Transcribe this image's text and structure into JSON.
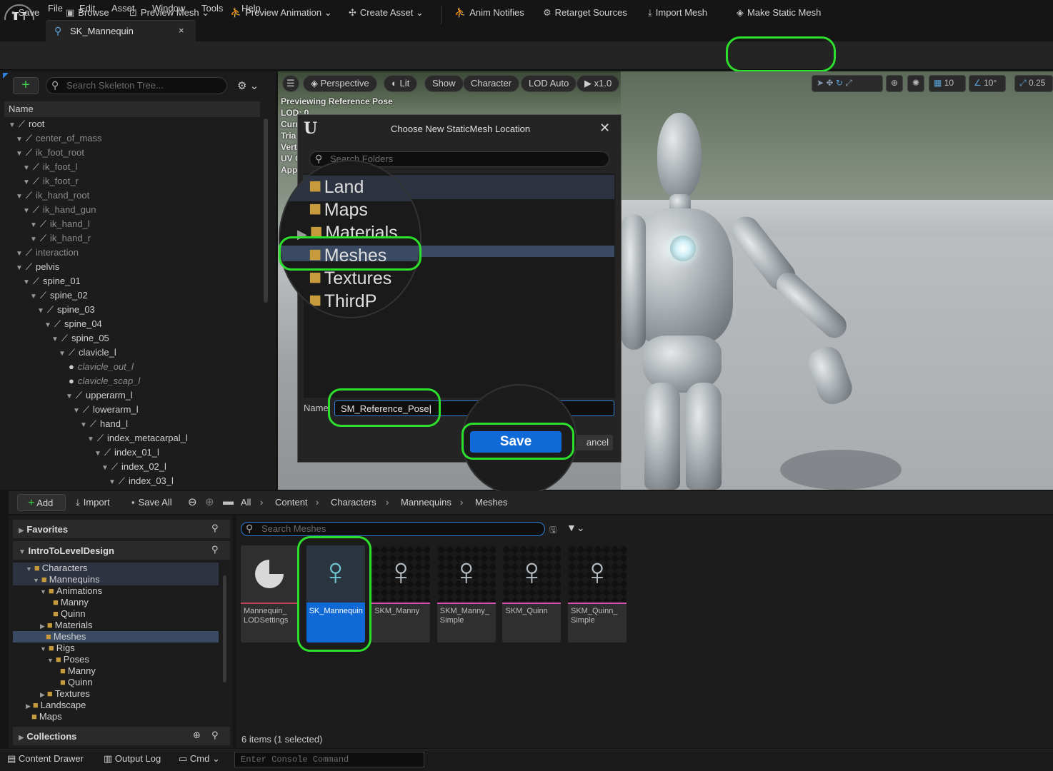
{
  "menu": [
    "File",
    "Edit",
    "Asset",
    "Window",
    "Tools",
    "Help"
  ],
  "doc_tab": {
    "label": "SK_Mannequin",
    "close": "×"
  },
  "toolbar": {
    "save": "Save",
    "browse": "Browse",
    "preview_mesh": "Preview Mesh",
    "preview_animation": "Preview Animation",
    "create_asset": "Create Asset",
    "anim_notifies": "Anim Notifies",
    "retarget_sources": "Retarget Sources",
    "import_mesh": "Import Mesh",
    "make_static_mesh": "Make Static Mesh"
  },
  "skeleton": {
    "search_placeholder": "Search Skeleton Tree...",
    "column_name": "Name",
    "rows": [
      {
        "label": "root",
        "depth": 0,
        "style": "normal"
      },
      {
        "label": "center_of_mass",
        "depth": 1,
        "style": "dim"
      },
      {
        "label": "ik_foot_root",
        "depth": 1,
        "style": "dim"
      },
      {
        "label": "ik_foot_l",
        "depth": 2,
        "style": "dim"
      },
      {
        "label": "ik_foot_r",
        "depth": 2,
        "style": "dim"
      },
      {
        "label": "ik_hand_root",
        "depth": 1,
        "style": "dim"
      },
      {
        "label": "ik_hand_gun",
        "depth": 2,
        "style": "dim"
      },
      {
        "label": "ik_hand_l",
        "depth": 3,
        "style": "dim"
      },
      {
        "label": "ik_hand_r",
        "depth": 3,
        "style": "dim"
      },
      {
        "label": "interaction",
        "depth": 1,
        "style": "dim"
      },
      {
        "label": "pelvis",
        "depth": 1,
        "style": "normal"
      },
      {
        "label": "spine_01",
        "depth": 2,
        "style": "normal"
      },
      {
        "label": "spine_02",
        "depth": 3,
        "style": "normal"
      },
      {
        "label": "spine_03",
        "depth": 4,
        "style": "normal"
      },
      {
        "label": "spine_04",
        "depth": 5,
        "style": "normal"
      },
      {
        "label": "spine_05",
        "depth": 6,
        "style": "normal"
      },
      {
        "label": "clavicle_l",
        "depth": 7,
        "style": "normal"
      },
      {
        "label": "clavicle_out_l",
        "depth": 8,
        "style": "italic"
      },
      {
        "label": "clavicle_scap_l",
        "depth": 8,
        "style": "italic"
      },
      {
        "label": "upperarm_l",
        "depth": 8,
        "style": "normal"
      },
      {
        "label": "lowerarm_l",
        "depth": 9,
        "style": "normal"
      },
      {
        "label": "hand_l",
        "depth": 10,
        "style": "normal"
      },
      {
        "label": "index_metacarpal_l",
        "depth": 11,
        "style": "normal"
      },
      {
        "label": "index_01_l",
        "depth": 12,
        "style": "normal"
      },
      {
        "label": "index_02_l",
        "depth": 13,
        "style": "normal"
      },
      {
        "label": "index_03_l",
        "depth": 14,
        "style": "normal"
      }
    ]
  },
  "viewport": {
    "buttons": {
      "perspective": "Perspective",
      "lit": "Lit",
      "show": "Show",
      "character": "Character",
      "lod": "LOD Auto",
      "speed": "x1.0"
    },
    "grid_snap": "10",
    "rot_snap": "10°",
    "scale_snap": "0.25",
    "info": [
      "Previewing Reference Pose",
      "LOD: 0",
      "Curr",
      "Tria",
      "Vert",
      "UV C",
      "App"
    ]
  },
  "dialog": {
    "title": "Choose New StaticMesh Location",
    "search_placeholder": "Search Folders",
    "folders": [
      "Land",
      "Maps",
      "Materials",
      "Meshes",
      "Textures",
      "ThirdP"
    ],
    "name_label": "Name",
    "name_value": "SM_Reference_Pose",
    "save": "Save",
    "cancel": "ancel"
  },
  "content_browser": {
    "add": "Add",
    "import": "Import",
    "save_all": "Save All",
    "breadcrumb": [
      "All",
      "Content",
      "Characters",
      "Mannequins",
      "Meshes"
    ],
    "favorites": "Favorites",
    "project": "IntroToLevelDesign",
    "collections": "Collections",
    "folders": [
      {
        "label": "Characters",
        "depth": 1,
        "state": "hov"
      },
      {
        "label": "Mannequins",
        "depth": 2,
        "state": "hov"
      },
      {
        "label": "Animations",
        "depth": 3,
        "state": ""
      },
      {
        "label": "Manny",
        "depth": 4,
        "state": ""
      },
      {
        "label": "Quinn",
        "depth": 4,
        "state": ""
      },
      {
        "label": "Materials",
        "depth": 3,
        "state": ""
      },
      {
        "label": "Meshes",
        "depth": 3,
        "state": "sel"
      },
      {
        "label": "Rigs",
        "depth": 3,
        "state": ""
      },
      {
        "label": "Poses",
        "depth": 4,
        "state": ""
      },
      {
        "label": "Manny",
        "depth": 5,
        "state": ""
      },
      {
        "label": "Quinn",
        "depth": 5,
        "state": ""
      },
      {
        "label": "Textures",
        "depth": 3,
        "state": ""
      },
      {
        "label": "Landscape",
        "depth": 1,
        "state": ""
      },
      {
        "label": "Maps",
        "depth": 1,
        "state": ""
      }
    ],
    "search_placeholder": "Search Meshes",
    "assets": [
      {
        "label": "Mannequin_ LODSettings",
        "kind": "settings"
      },
      {
        "label": "SK_Mannequin",
        "kind": "skeleton",
        "selected": true
      },
      {
        "label": "SKM_Manny",
        "kind": "mesh"
      },
      {
        "label": "SKM_Manny_ Simple",
        "kind": "mesh"
      },
      {
        "label": "SKM_Quinn",
        "kind": "mesh"
      },
      {
        "label": "SKM_Quinn_ Simple",
        "kind": "mesh"
      }
    ],
    "item_count": "6 items (1 selected)"
  },
  "statusbar": {
    "content_drawer": "Content Drawer",
    "output_log": "Output Log",
    "cmd": "Cmd",
    "console_placeholder": "Enter Console Command"
  },
  "colors": {
    "highlight": "#2ee02e",
    "selection_blue": "#0f6ad8",
    "folder": "#c79b3b"
  }
}
